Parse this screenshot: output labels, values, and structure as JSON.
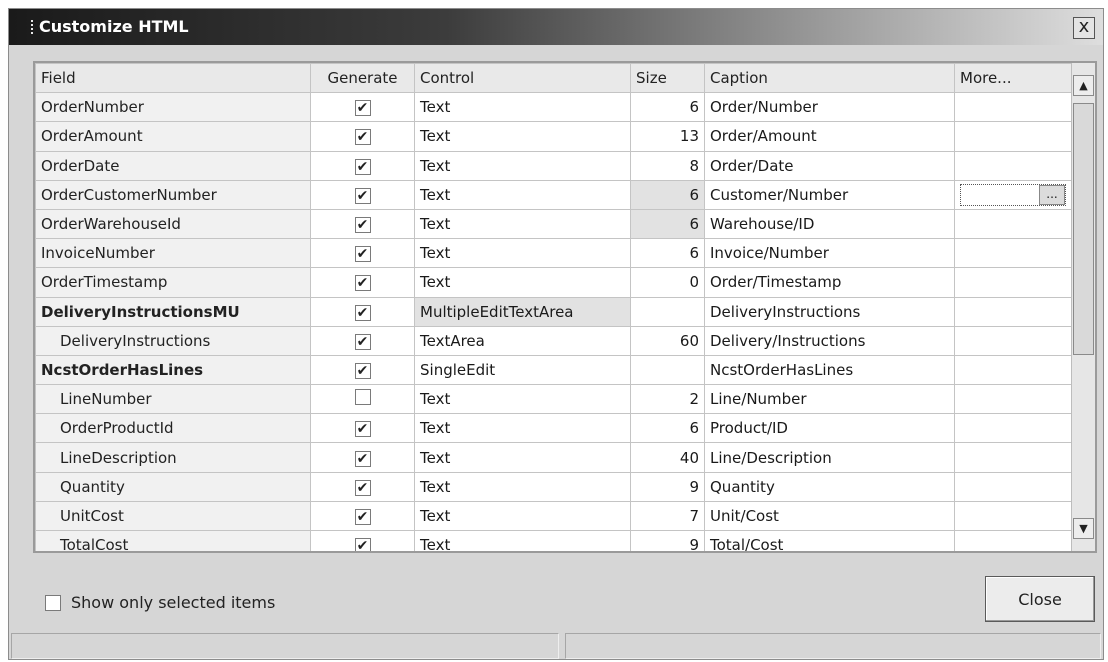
{
  "window": {
    "title": "Customize HTML",
    "close_glyph": "x"
  },
  "grid": {
    "columns": [
      "Field",
      "Generate",
      "Control",
      "Size",
      "Caption",
      "More..."
    ],
    "rows": [
      {
        "field": "OrderNumber",
        "generate": true,
        "control": "Text",
        "size": "6",
        "caption": "Order/Number"
      },
      {
        "field": "OrderAmount",
        "generate": true,
        "control": "Text",
        "size": "13",
        "caption": "Order/Amount"
      },
      {
        "field": "OrderDate",
        "generate": true,
        "control": "Text",
        "size": "8",
        "caption": "Order/Date"
      },
      {
        "field": "OrderCustomerNumber",
        "generate": true,
        "control": "Text",
        "size": "6",
        "caption": "Customer/Number"
      },
      {
        "field": "OrderWarehouseId",
        "generate": true,
        "control": "Text",
        "size": "6",
        "caption": "Warehouse/ID"
      },
      {
        "field": "InvoiceNumber",
        "generate": true,
        "control": "Text",
        "size": "6",
        "caption": "Invoice/Number"
      },
      {
        "field": "OrderTimestamp",
        "generate": true,
        "control": "Text",
        "size": "0",
        "caption": "Order/Timestamp"
      },
      {
        "field": "DeliveryInstructionsMU",
        "generate": true,
        "control": "MultipleEditTextArea",
        "size": "",
        "caption": "DeliveryInstructions"
      },
      {
        "field": "DeliveryInstructions",
        "generate": true,
        "control": "TextArea",
        "size": "60",
        "caption": "Delivery/Instructions"
      },
      {
        "field": "NcstOrderHasLines",
        "generate": true,
        "control": "SingleEdit",
        "size": "",
        "caption": "NcstOrderHasLines"
      },
      {
        "field": "LineNumber",
        "generate": false,
        "control": "Text",
        "size": "2",
        "caption": "Line/Number"
      },
      {
        "field": "OrderProductId",
        "generate": true,
        "control": "Text",
        "size": "6",
        "caption": "Product/ID"
      },
      {
        "field": "LineDescription",
        "generate": true,
        "control": "Text",
        "size": "40",
        "caption": "Line/Description"
      },
      {
        "field": "Quantity",
        "generate": true,
        "control": "Text",
        "size": "9",
        "caption": "Quantity"
      },
      {
        "field": "UnitCost",
        "generate": true,
        "control": "Text",
        "size": "7",
        "caption": "Unit/Cost"
      },
      {
        "field": "TotalCost",
        "generate": true,
        "control": "Text",
        "size": "9",
        "caption": "Total/Cost"
      }
    ],
    "more_button_label": "...",
    "check_glyph": "✔"
  },
  "scrollbar": {
    "up_glyph": "▲",
    "down_glyph": "▼"
  },
  "footer": {
    "show_selected_label": "Show only selected items",
    "show_selected_checked": false,
    "close_label": "Close"
  }
}
